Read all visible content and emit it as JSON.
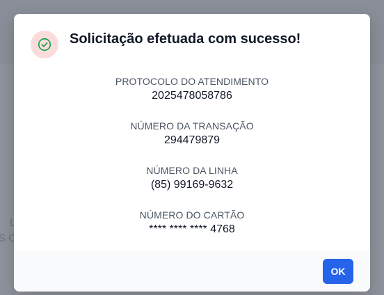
{
  "background": {
    "partial_text_1": "L",
    "partial_text_2": "S O"
  },
  "dialog": {
    "title": "Solicitação efetuada com sucesso!",
    "icon": "check-circle-icon",
    "accent_color": "#2563eb",
    "icon_color": "#16a34a",
    "icon_bg_color": "#fbdcdc",
    "items": [
      {
        "label": "PROTOCOLO DO ATENDIMENTO",
        "value": "2025478058786"
      },
      {
        "label": "NÚMERO DA TRANSAÇÃO",
        "value": "294479879"
      },
      {
        "label": "NÚMERO DA LINHA",
        "value": "(85) 99169-9632"
      },
      {
        "label": "NÚMERO DO CARTÃO",
        "value": "**** **** **** 4768"
      }
    ],
    "ok_label": "OK"
  }
}
